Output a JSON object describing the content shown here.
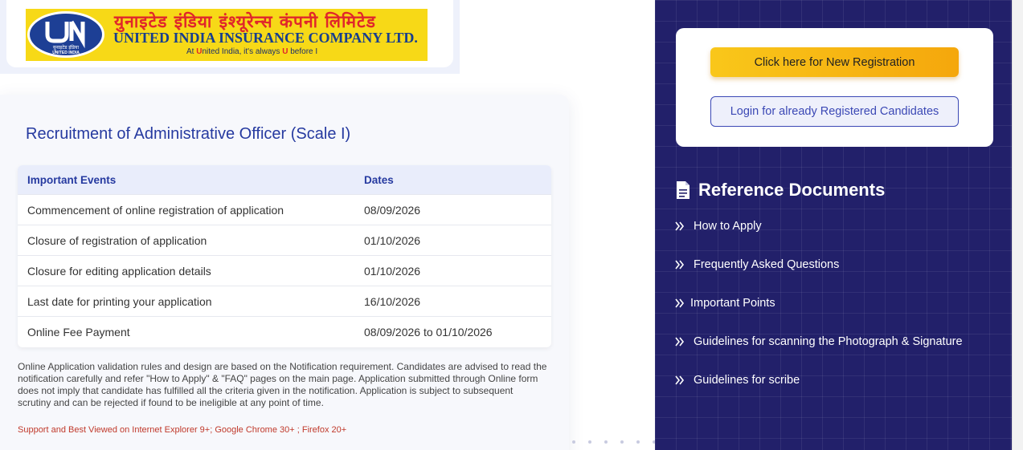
{
  "header": {
    "logo_hindi": "युनाइटेड इंडिया इंश्यूरेन्स कंपनी लिमिटेड",
    "logo_english": "UNITED INDIA INSURANCE COMPANY LTD.",
    "logo_emblem_text": "युनाइटेड इंडिया UNITED INDIA",
    "tagline_pre": "At ",
    "tagline_u1": "U",
    "tagline_mid": "nited India, it's always ",
    "tagline_u2": "U",
    "tagline_post": " before I"
  },
  "main": {
    "title": "Recruitment of Administrative Officer (Scale I)",
    "table": {
      "headers": [
        "Important Events",
        "Dates"
      ],
      "rows": [
        [
          "Commencement of online registration of application",
          "08/09/2026"
        ],
        [
          "Closure of registration of application",
          "01/10/2026"
        ],
        [
          "Closure for editing application details",
          "01/10/2026"
        ],
        [
          "Last date for printing your application",
          "16/10/2026"
        ],
        [
          "Online Fee Payment",
          "08/09/2026 to 01/10/2026"
        ]
      ]
    },
    "note": "Online Application validation rules and design are based on the Notification requirement. Candidates are advised to read the notification carefully and refer \"How to Apply\" & \"FAQ\" pages on the main page. Application submitted through Online form does not imply that candidate has fulfilled all the criteria given in the notification. Application is subject to subsequent scrutiny and can be rejected if found to be ineligible at any point of time.",
    "support": "Support and Best Viewed on Internet Explorer 9+; Google Chrome 30+ ; Firefox 20+"
  },
  "sidebar": {
    "new_registration_label": "Click here for New Registration",
    "login_label": "Login for already Registered Candidates",
    "reference_title": "Reference Documents",
    "reference_icon": "document-icon",
    "items": [
      {
        "label": "How to Apply",
        "icon": "double-chevron-right-icon"
      },
      {
        "label": "Frequently Asked Questions",
        "icon": "double-chevron-right-icon"
      },
      {
        "label": "Important Points",
        "icon": "double-chevron-right-icon"
      },
      {
        "label": "Guidelines for scanning the Photograph & Signature",
        "icon": "double-chevron-right-icon"
      },
      {
        "label": "Guidelines for scribe",
        "icon": "double-chevron-right-icon"
      }
    ]
  },
  "colors": {
    "brand_blue": "#263aa0",
    "sidebar_bg": "#22206a",
    "accent_yellow": "#f9c71a",
    "warning_red": "#c0392b"
  }
}
